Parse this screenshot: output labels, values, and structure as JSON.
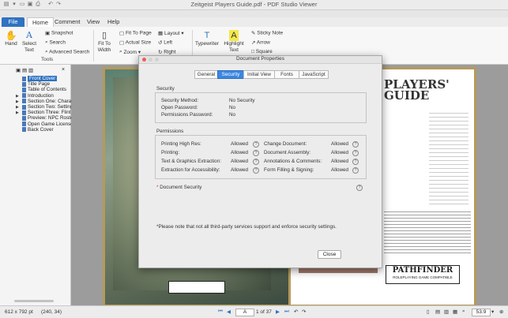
{
  "window": {
    "title": "Zeitgeist Players Guide.pdf - PDF Studio Viewer"
  },
  "tabs": [
    {
      "label": "File"
    },
    {
      "label": "Home"
    },
    {
      "label": "Comment"
    },
    {
      "label": "View"
    },
    {
      "label": "Help"
    }
  ],
  "ribbon": {
    "hand": "Hand",
    "select_text": "Select Text",
    "snapshot": "Snapshot",
    "search": "Search",
    "advanced_search": "Advanced Search",
    "tools_group": "Tools",
    "fit_to_width": "Fit To Width",
    "fit_to_page": "Fit To Page",
    "actual_size": "Actual Size",
    "zoom": "Zoom",
    "layout": "Layout",
    "left": "Left",
    "right": "Right",
    "typewriter": "Typewriter",
    "highlight_text": "Highlight Text",
    "sticky_note": "Sticky Note",
    "arrow": "Arrow",
    "square": "Square"
  },
  "bookmarks": [
    {
      "label": "Front Cover",
      "selected": true,
      "expandable": false
    },
    {
      "label": "Title Page",
      "selected": false,
      "expandable": false
    },
    {
      "label": "Table of Contents",
      "selected": false,
      "expandable": false
    },
    {
      "label": "Introduction",
      "selected": false,
      "expandable": true
    },
    {
      "label": "Section One: Charac",
      "selected": false,
      "expandable": true
    },
    {
      "label": "Section Two: Setting",
      "selected": false,
      "expandable": true
    },
    {
      "label": "Section Three: Flint",
      "selected": false,
      "expandable": true
    },
    {
      "label": "Preview: NPC Roster",
      "selected": false,
      "expandable": false
    },
    {
      "label": "Open Game License",
      "selected": false,
      "expandable": false
    },
    {
      "label": "Back Cover",
      "selected": false,
      "expandable": false
    }
  ],
  "dialog": {
    "title": "Document Properties",
    "tabs": [
      "General",
      "Security",
      "Initial View",
      "Fonts",
      "JavaScript"
    ],
    "active_tab": "Security",
    "security": {
      "heading": "Security",
      "rows": [
        {
          "label": "Security Method:",
          "value": "No Security"
        },
        {
          "label": "Open Password:",
          "value": "No"
        },
        {
          "label": "Permissions Password:",
          "value": "No"
        }
      ]
    },
    "permissions": {
      "heading": "Permissions",
      "left": [
        {
          "label": "Printing High Res:",
          "value": "Allowed"
        },
        {
          "label": "Printing:",
          "value": "Allowed"
        },
        {
          "label": "Text & Graphics Extraction:",
          "value": "Allowed"
        },
        {
          "label": "Extraction for Accessibility:",
          "value": "Allowed"
        }
      ],
      "right": [
        {
          "label": "Change Document:",
          "value": "Allowed"
        },
        {
          "label": "Document Assembly:",
          "value": "Allowed"
        },
        {
          "label": "Annotations & Comments:",
          "value": "Allowed"
        },
        {
          "label": "Form Filling & Signing:",
          "value": "Allowed"
        }
      ]
    },
    "document_security": "Document Security",
    "note": "*Please note that not all third-party services support and enforce security settings.",
    "close": "Close"
  },
  "page_cover": {
    "title": "PLAYERS' GUIDE",
    "pathfinder": "PATHFINDER",
    "pathfinder_sub": "ROLEPLAYING GAME COMPATIBLE"
  },
  "statusbar": {
    "page_size": "612 x 792 pt",
    "coords": "(240, 34)",
    "page_label": "A",
    "page_of": "1 of 37",
    "zoom": "53.9"
  }
}
